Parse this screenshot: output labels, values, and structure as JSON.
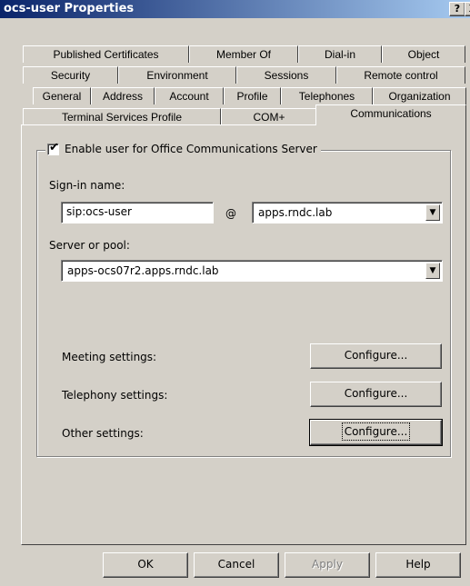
{
  "window": {
    "title": "ocs-user Properties",
    "help_glyph": "?",
    "close_glyph": "X"
  },
  "tabs": {
    "row1": [
      "Published Certificates",
      "Member Of",
      "Dial-in",
      "Object"
    ],
    "row2": [
      "Security",
      "Environment",
      "Sessions",
      "Remote control"
    ],
    "row3": [
      "General",
      "Address",
      "Account",
      "Profile",
      "Telephones",
      "Organization"
    ],
    "row4": [
      "Terminal Services Profile",
      "COM+",
      "Communications"
    ],
    "active": "Communications"
  },
  "communications": {
    "enable_label": "Enable user for Office Communications Server",
    "enable_checked": true,
    "signin_label": "Sign-in name:",
    "signin_value": "sip:ocs-user",
    "at_symbol": "@",
    "domain_value": "apps.rndc.lab",
    "server_label": "Server or pool:",
    "server_value": "apps-ocs07r2.apps.rndc.lab",
    "meeting_label": "Meeting settings:",
    "telephony_label": "Telephony settings:",
    "other_label": "Other settings:",
    "configure_label": "Configure..."
  },
  "footer": {
    "ok": "OK",
    "cancel": "Cancel",
    "apply": "Apply",
    "help": "Help"
  },
  "icons": {
    "check": "✔",
    "dropdown": "▼"
  }
}
